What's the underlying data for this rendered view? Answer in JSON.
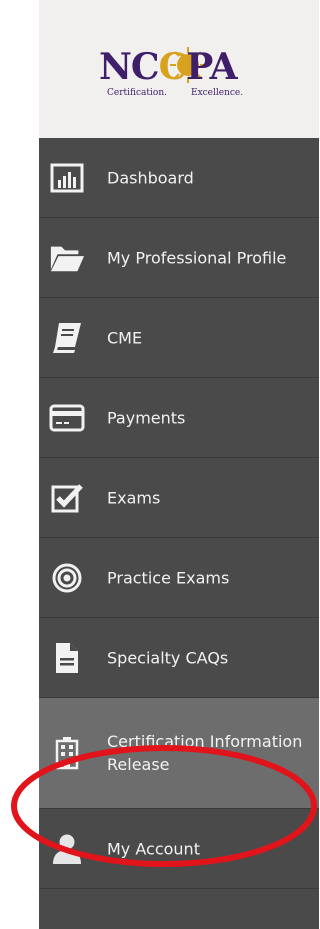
{
  "logo": {
    "letters_part1": "NC",
    "letters_gold": "C",
    "letters_part2": "PA",
    "tagline_1": "Certification.",
    "tagline_2": "Excellence."
  },
  "nav": {
    "items": [
      {
        "label": "Dashboard",
        "icon": "bar-chart-icon"
      },
      {
        "label": "My Professional Profile",
        "icon": "folder-icon"
      },
      {
        "label": "CME",
        "icon": "book-icon"
      },
      {
        "label": "Payments",
        "icon": "credit-card-icon"
      },
      {
        "label": "Exams",
        "icon": "checkbox-icon"
      },
      {
        "label": "Practice Exams",
        "icon": "target-icon"
      },
      {
        "label": "Specialty CAQs",
        "icon": "document-icon"
      },
      {
        "label": "Certification Information Release",
        "icon": "building-icon",
        "active": true
      },
      {
        "label": "My Account",
        "icon": "user-icon"
      }
    ]
  },
  "colors": {
    "sidebar_bg": "#4a4a4a",
    "active_bg": "#6d6d6d",
    "text": "#f2f2f2",
    "logo_purple": "#3f1f6a",
    "logo_gold": "#d8a21f",
    "annotation_red": "#e0141a"
  }
}
